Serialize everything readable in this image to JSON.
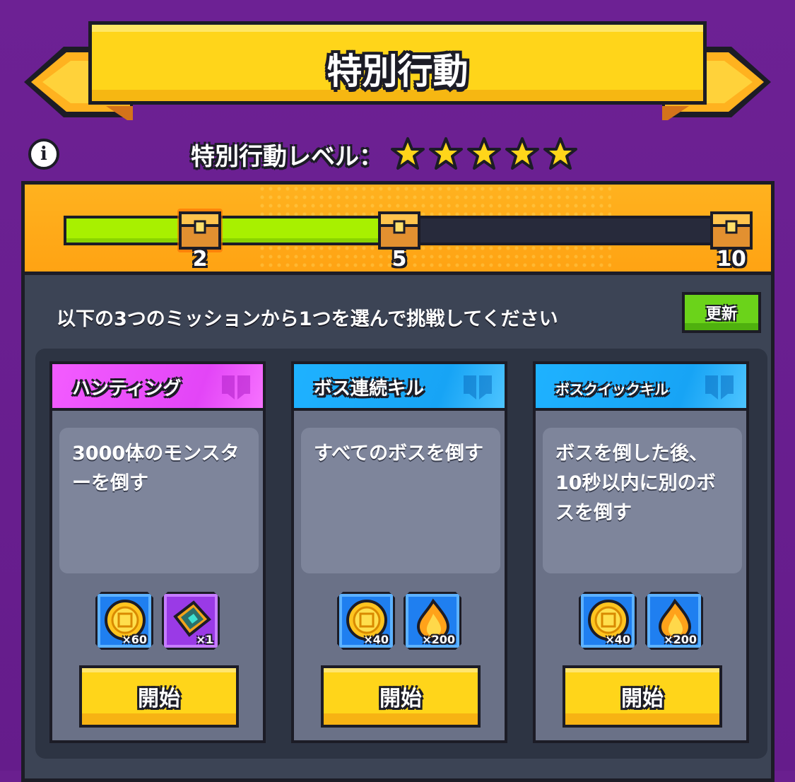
{
  "title": "特別行動",
  "level": {
    "label": "特別行動レベル：",
    "stars": 5
  },
  "progress": {
    "current": 6,
    "milestones": [
      {
        "value": "2"
      },
      {
        "value": "5"
      },
      {
        "value": "10"
      }
    ]
  },
  "instruction": "以下の3つのミッションから1つを選んで挑戦してください",
  "refresh_label": "更新",
  "missions": [
    {
      "name": "ハンティング",
      "color": "#e345f7",
      "description": "3000体のモンスターを倒す",
      "rewards": [
        {
          "icon": "gold-coin-icon",
          "qty": "×60"
        },
        {
          "icon": "blueprint-scroll-icon",
          "qty": "×1"
        }
      ],
      "start_label": "開始"
    },
    {
      "name": "ボス連続キル",
      "color": "#17a4f5",
      "description": "すべてのボスを倒す",
      "rewards": [
        {
          "icon": "gold-coin-icon",
          "qty": "×40"
        },
        {
          "icon": "flame-essence-icon",
          "qty": "×200"
        }
      ],
      "start_label": "開始"
    },
    {
      "name": "ボスクイックキル",
      "color": "#17a4f5",
      "description": "ボスを倒した後、10秒以内に別のボスを倒す",
      "rewards": [
        {
          "icon": "gold-coin-icon",
          "qty": "×40"
        },
        {
          "icon": "flame-essence-icon",
          "qty": "×200"
        }
      ],
      "start_label": "開始"
    }
  ]
}
